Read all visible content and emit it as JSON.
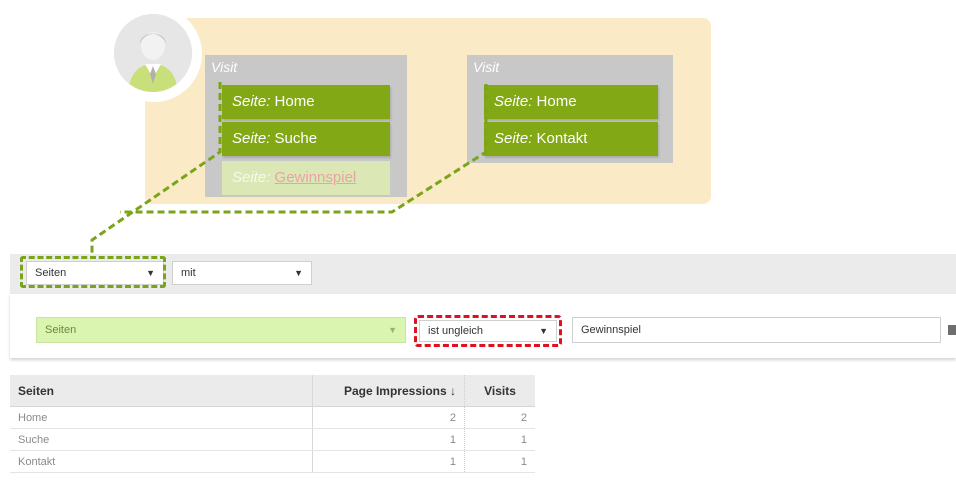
{
  "diagram": {
    "visits": [
      {
        "label": "Visit",
        "pages": [
          {
            "key": "Seite:",
            "value": "Home"
          },
          {
            "key": "Seite:",
            "value": "Suche"
          },
          {
            "key": "Seite:",
            "value": "Gewinnspiel"
          }
        ]
      },
      {
        "label": "Visit",
        "pages": [
          {
            "key": "Seite:",
            "value": "Home"
          },
          {
            "key": "Seite:",
            "value": "Kontakt"
          }
        ]
      }
    ]
  },
  "filter": {
    "dimension_select": "Seiten",
    "mode_select": "mit",
    "condition": {
      "field_select": "Seiten",
      "operator_select": "ist ungleich",
      "value_input": "Gewinnspiel"
    }
  },
  "table": {
    "columns": [
      "Seiten",
      "Page Impressions ↓",
      "Visits"
    ],
    "rows": [
      [
        "Home",
        "2",
        "2"
      ],
      [
        "Suche",
        "1",
        "1"
      ],
      [
        "Kontakt",
        "1",
        "1"
      ]
    ]
  },
  "colors": {
    "accent_green": "#82a816",
    "dash_green": "#7aa41a",
    "dash_red": "#e01020",
    "diagram_bg": "#fbeac6"
  }
}
